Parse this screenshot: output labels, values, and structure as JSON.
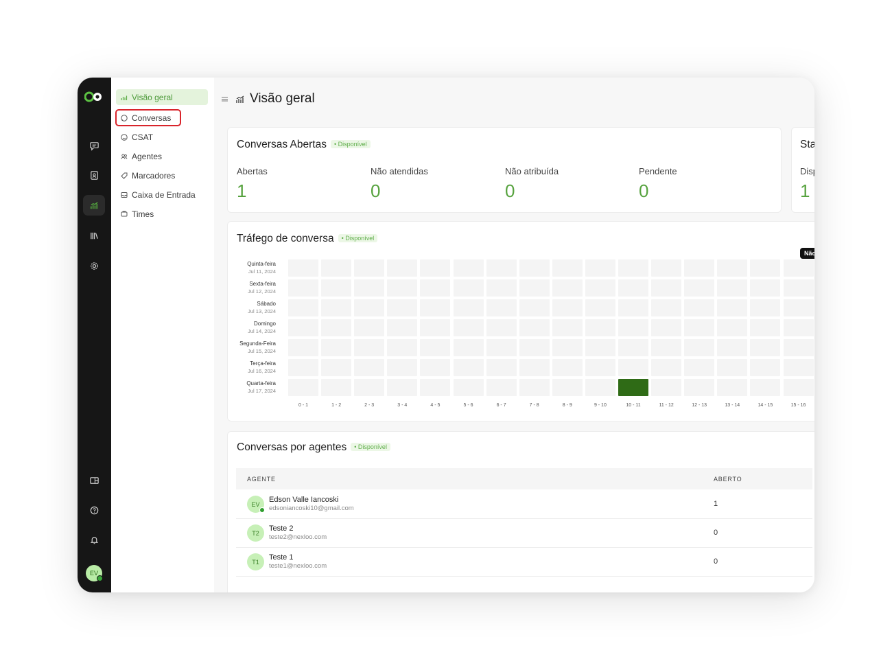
{
  "rail": {
    "items": [
      "conversations",
      "contacts",
      "reports",
      "library",
      "settings",
      "dashboard-apps",
      "help",
      "notifications"
    ],
    "avatar_initials": "EV"
  },
  "subnav": {
    "items": [
      {
        "label": "Visão geral",
        "icon": "chart-icon",
        "active": true
      },
      {
        "label": "Conversas",
        "icon": "chat-bubble-icon",
        "highlighted": true
      },
      {
        "label": "CSAT",
        "icon": "smile-icon"
      },
      {
        "label": "Agentes",
        "icon": "users-icon"
      },
      {
        "label": "Marcadores",
        "icon": "tag-icon"
      },
      {
        "label": "Caixa de Entrada",
        "icon": "inbox-icon"
      },
      {
        "label": "Times",
        "icon": "team-icon"
      }
    ]
  },
  "header": {
    "title": "Visão geral"
  },
  "open_conversations": {
    "title": "Conversas Abertas",
    "badge": "• Disponível",
    "metrics": [
      {
        "label": "Abertas",
        "value": "1"
      },
      {
        "label": "Não atendidas",
        "value": "0"
      },
      {
        "label": "Não atribuída",
        "value": "0"
      },
      {
        "label": "Pendente",
        "value": "0"
      }
    ]
  },
  "status_card": {
    "title": "Sta",
    "label": "Disp",
    "value": "1"
  },
  "traffic": {
    "title": "Tráfego de conversa",
    "badge": "• Disponível",
    "tooltip": "Nãc",
    "rows": [
      {
        "day": "Quinta-feira",
        "date": "Jul 11, 2024"
      },
      {
        "day": "Sexta-feira",
        "date": "Jul 12, 2024"
      },
      {
        "day": "Sábado",
        "date": "Jul 13, 2024"
      },
      {
        "day": "Domingo",
        "date": "Jul 14, 2024"
      },
      {
        "day": "Segunda-Feira",
        "date": "Jul 15, 2024"
      },
      {
        "day": "Terça-feira",
        "date": "Jul 16, 2024"
      },
      {
        "day": "Quarta-feira",
        "date": "Jul 17, 2024"
      }
    ],
    "hours": [
      "0 - 1",
      "1 - 2",
      "2 - 3",
      "3 - 4",
      "4 - 5",
      "5 - 6",
      "6 - 7",
      "7 - 8",
      "8 - 9",
      "9 - 10",
      "10 - 11",
      "11 - 12",
      "12 - 13",
      "13 - 14",
      "14 - 15",
      "15 - 16"
    ],
    "active_cells": [
      {
        "row": 6,
        "col": 10,
        "count": 1
      }
    ]
  },
  "agents": {
    "title": "Conversas por agentes",
    "badge": "• Disponível",
    "columns": [
      "AGENTE",
      "ABERTO"
    ],
    "rows": [
      {
        "initials": "EV",
        "name": "Edson Valle Iancoski",
        "email": "edsoniancoski10@gmail.com",
        "open": "1",
        "online": true
      },
      {
        "initials": "T2",
        "name": "Teste 2",
        "email": "teste2@nexloo.com",
        "open": "0",
        "online": false
      },
      {
        "initials": "T1",
        "name": "Teste 1",
        "email": "teste1@nexloo.com",
        "open": "0",
        "online": false
      }
    ]
  }
}
